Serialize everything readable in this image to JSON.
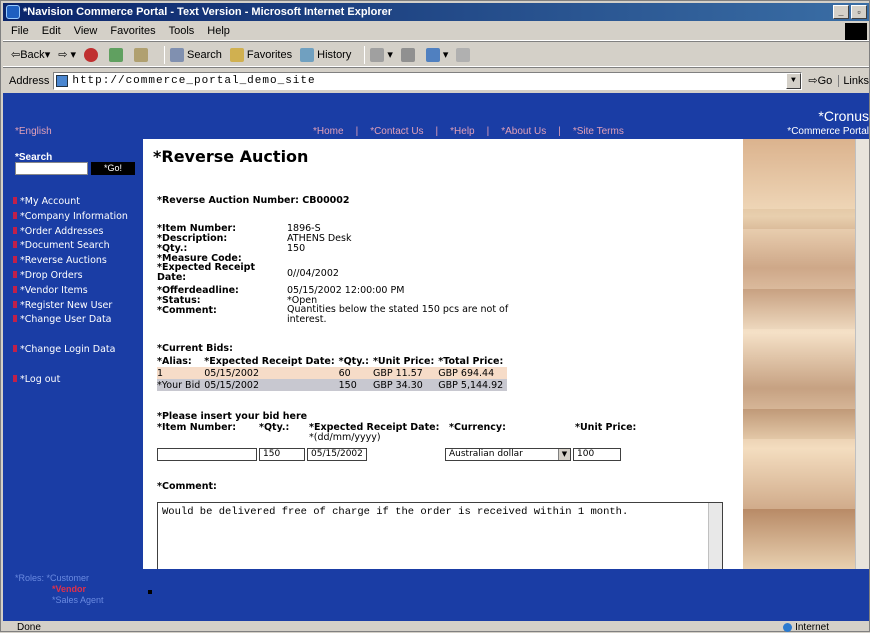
{
  "window": {
    "title": "*Navision Commerce Portal - Text Version - Microsoft Internet Explorer"
  },
  "menubar": [
    "File",
    "Edit",
    "View",
    "Favorites",
    "Tools",
    "Help"
  ],
  "toolbar": {
    "back": "Back",
    "search": "Search",
    "favorites": "Favorites",
    "history": "History"
  },
  "address": {
    "label": "Address",
    "url": "http://commerce_portal_demo_site",
    "go": "Go",
    "links": "Links"
  },
  "header": {
    "language": "*English",
    "nav": [
      "*Home",
      "|",
      "*Contact Us",
      "|",
      "*Help",
      "|",
      "*About Us",
      "|",
      "*Site Terms"
    ],
    "brand_line1": "*Cronus",
    "brand_line2": "*Commerce Portal"
  },
  "sidebar": {
    "search_label": "*Search",
    "go_label": "*Go!",
    "items": [
      "*My Account",
      "*Company Information",
      "*Order Addresses",
      "*Document Search",
      "*Reverse Auctions",
      "*Drop Orders",
      "*Vendor Items",
      "*Register New User",
      "*Change User Data",
      "",
      "*Change Login Data",
      "",
      "*Log out"
    ]
  },
  "page": {
    "title": "*Reverse Auction",
    "auction_number_label": "*Reverse Auction Number: CB00002",
    "fields": [
      {
        "label": "*Item Number:",
        "value": "1896-S"
      },
      {
        "label": "*Description:",
        "value": "ATHENS Desk"
      },
      {
        "label": "*Qty.:",
        "value": "150"
      },
      {
        "label": "*Measure Code:",
        "value": ""
      },
      {
        "label": "*Expected Receipt Date:",
        "value": "0//04/2002"
      },
      {
        "label": "*Offerdeadline:",
        "value": "05/15/2002 12:00:00 PM"
      },
      {
        "label": "*Status:",
        "value": "*Open"
      },
      {
        "label": "*Comment:",
        "value": "Quantities below the stated 150 pcs are not of interest."
      }
    ],
    "current_bids": {
      "label": "*Current Bids:",
      "headers": [
        "*Alias:",
        "*Expected Receipt Date:",
        "*Qty.:",
        "*Unit Price:",
        "*Total Price:"
      ],
      "rows": [
        [
          "1",
          "05/15/2002",
          "60",
          "GBP 11.57",
          "GBP 694.44"
        ],
        [
          "*Your Bid",
          "05/15/2002",
          "150",
          "GBP 34.30",
          "GBP 5,144.92"
        ]
      ]
    },
    "bid_form": {
      "label": "*Please insert your bid here",
      "item_number_label": "*Item Number:",
      "qty_label": "*Qty.:",
      "date_label": "*Expected Receipt Date:",
      "date_hint": "*(dd/mm/yyyy)",
      "currency_label": "*Currency:",
      "unit_price_label": "*Unit Price:",
      "item_number_value": "",
      "qty_value": "150",
      "date_value": "05/15/2002",
      "currency_value": "Australian dollar",
      "unit_price_value": "100"
    },
    "comment_label": "*Comment:",
    "comment_value": "Would be delivered free of charge if the order is received within 1 month."
  },
  "footer": {
    "roles_label": "*Roles:",
    "roles": [
      "*Customer",
      "*Vendor",
      "*Sales Agent"
    ]
  },
  "statusbar": {
    "text": "Done",
    "zone": "Internet"
  }
}
